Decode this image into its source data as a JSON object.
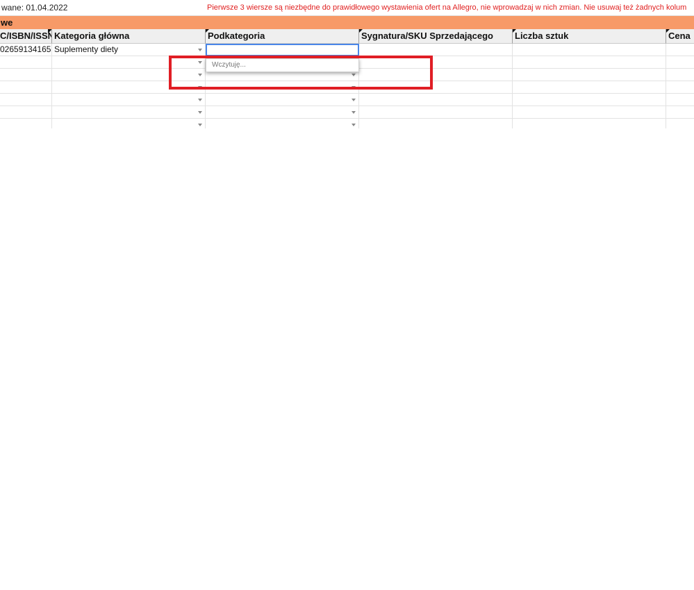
{
  "sheet": {
    "row1": {
      "date_text": "wane: 01.04.2022",
      "notice": "Pierwsze 3 wiersze są niezbędne do prawidłowego wystawienia ofert na Allegro, nie wprowadzaj w nich zmian. Nie usuwaj też żadnych kolum"
    },
    "row2": {
      "section_label": "we"
    },
    "headers": [
      "C/ISBN/ISSN",
      "Kategoria główna",
      "Podkategoria",
      "Sygnatura/SKU Sprzedającego",
      "Liczba sztuk",
      "Cena"
    ],
    "data_rows": [
      {
        "ean": "02659134165",
        "category": "Suplementy diety",
        "subcategory": ""
      },
      {
        "ean": "",
        "category": "",
        "subcategory": ""
      },
      {
        "ean": "",
        "category": "",
        "subcategory": ""
      },
      {
        "ean": "",
        "category": "",
        "subcategory": ""
      },
      {
        "ean": "",
        "category": "",
        "subcategory": ""
      },
      {
        "ean": "",
        "category": "",
        "subcategory": ""
      }
    ]
  },
  "dropdown": {
    "loading_text": "Wczytuję..."
  },
  "colors": {
    "section_header_bg": "#f79a68",
    "notice_text": "#e02020",
    "highlight_border": "#e01e25",
    "selection_outline": "#4a86e8"
  },
  "icons": {
    "dropdown_arrow": "chevron-down-icon",
    "note_indicator": "comment-indicator-icon"
  }
}
